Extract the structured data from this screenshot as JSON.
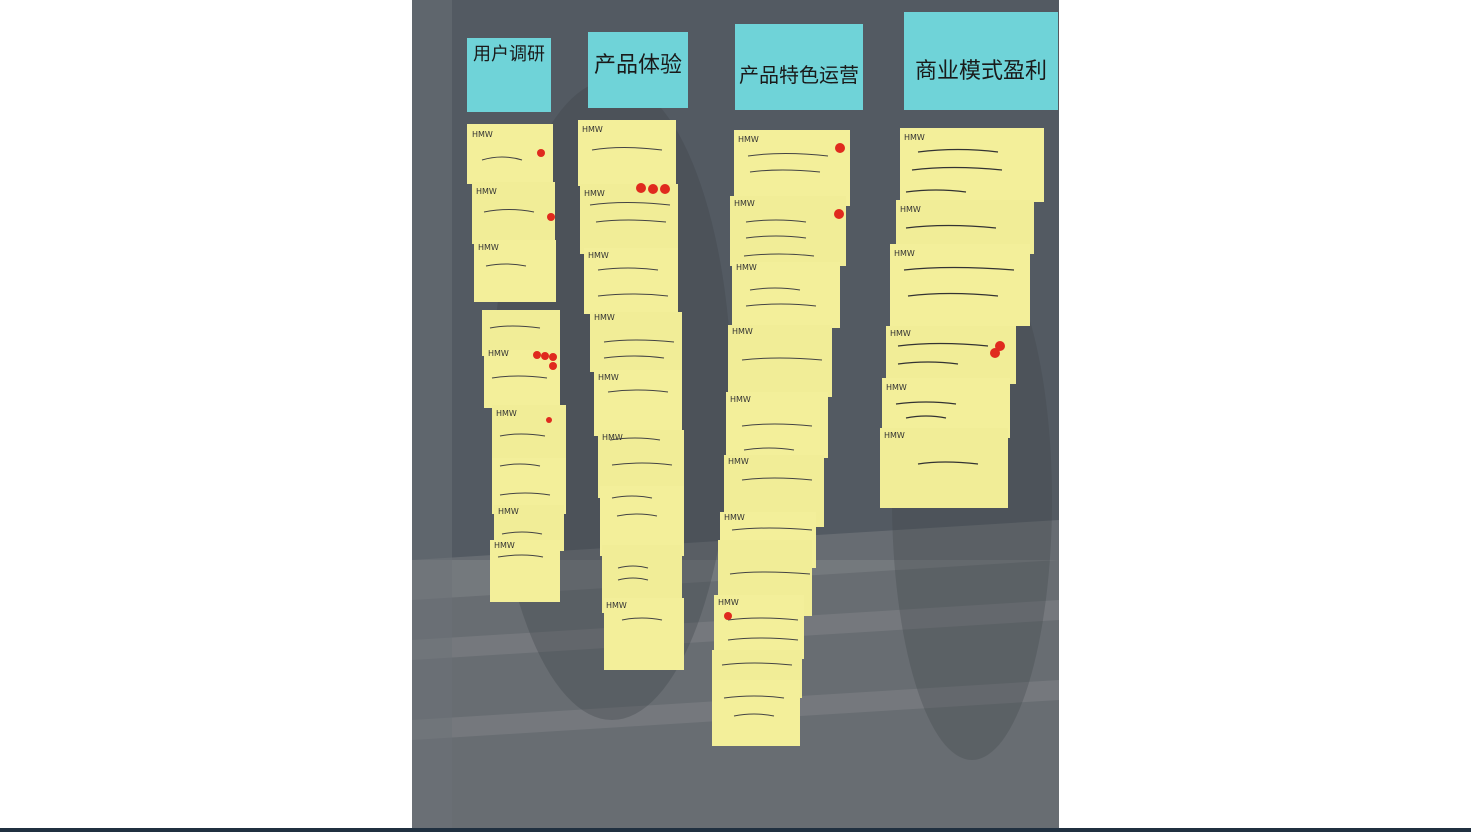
{
  "photo": {
    "headers": [
      "用户调研",
      "产品体验",
      "产品特色运营",
      "商业模式盈利"
    ],
    "colors": {
      "header_note": "#6fd3d8",
      "sticky_note": "#f3ef9a",
      "dot": "#e02a1e",
      "board": "#4f565e"
    },
    "notes": {
      "col1": [
        "HMW",
        "HMW",
        "HMW",
        "HMW",
        "HMW",
        "HMW",
        "HMW"
      ],
      "col2": [
        "HMW",
        "HMW",
        "HMW",
        "HMW",
        "HMW",
        "HMW",
        "HMW"
      ],
      "col3": [
        "HMW",
        "HMW",
        "HMW",
        "HMW",
        "HMW",
        "HMW",
        "HMW",
        "HMW"
      ],
      "col4": [
        "HMW",
        "HMW",
        "HMW",
        "HMW",
        "HMW",
        "HMW"
      ]
    }
  }
}
